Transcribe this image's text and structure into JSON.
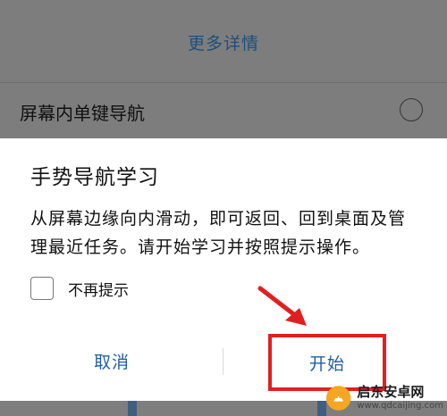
{
  "background": {
    "more_details": "更多详情",
    "option_label": "屏幕内单键导航"
  },
  "dialog": {
    "title": "手势导航学习",
    "message": "从屏幕边缘向内滑动，即可返回、回到桌面及管理最近任务。请开始学习并按照提示操作。",
    "checkbox_label": "不再提示",
    "cancel_label": "取消",
    "start_label": "开始"
  },
  "watermark": {
    "title": "启东安卓网",
    "url": "www.qdcaijing.com"
  },
  "colors": {
    "accent_text": "#1f5ea8",
    "annotation": "#e02020",
    "overlay": "#7d7d7d"
  }
}
